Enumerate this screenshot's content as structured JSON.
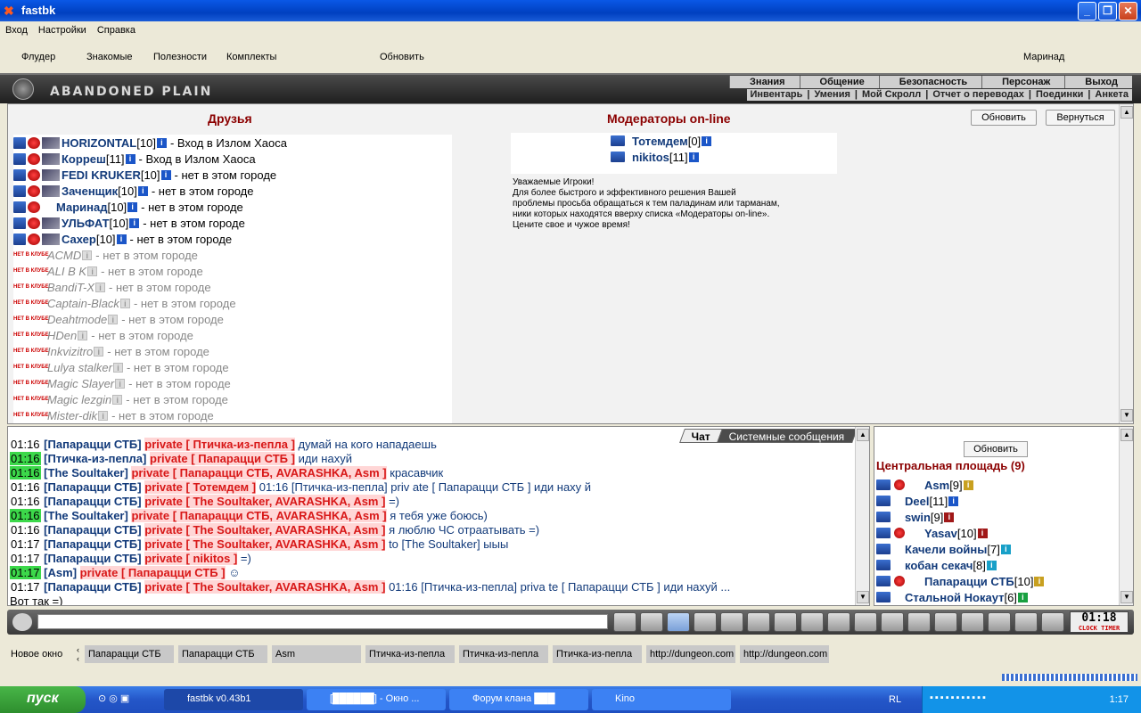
{
  "window": {
    "title": "fastbk"
  },
  "menubar": [
    "Вход",
    "Настройки",
    "Справка"
  ],
  "toolbar": {
    "items": [
      "Флудер",
      "Знакомые",
      "Полезности",
      "Комплекты",
      "Обновить"
    ],
    "user": "Маринад"
  },
  "game": {
    "brand": "ABANDONED PLAIN",
    "menu_top": [
      "Знания",
      "Общение",
      "Безопасность",
      "Персонаж",
      "Выход"
    ],
    "menu_bottom": [
      "Инвентарь",
      "Умения",
      "Мой Скролл",
      "Отчет о переводах",
      "Поединки",
      "Анкета"
    ]
  },
  "friends": {
    "title": "Друзья",
    "refresh": "Обновить",
    "back": "Вернуться",
    "online": [
      {
        "nick": "HORIZONTAL",
        "level": "[10]",
        "status": "- Вход в Излом Хаоса"
      },
      {
        "nick": "Корреш",
        "level": "[11]",
        "status": "- Вход в Излом Хаоса"
      },
      {
        "nick": "FEDI KRUKER",
        "level": "[10]",
        "status": "- нет в этом городе"
      },
      {
        "nick": "Заченщик",
        "level": "[10]",
        "status": "- нет в этом городе"
      },
      {
        "nick": "Маринад",
        "level": "[10]",
        "status": "- нет в этом городе"
      },
      {
        "nick": "УЛЬФАТ",
        "level": "[10]",
        "status": "- нет в этом городе"
      },
      {
        "nick": "Сахер",
        "level": "[10]",
        "status": "- нет в этом городе"
      }
    ],
    "offline_badge": "НЕТ В КЛУБЕ",
    "offline": [
      {
        "nick": "ACMD",
        "status": "- нет в этом городе"
      },
      {
        "nick": "ALI B K",
        "status": "- нет в этом городе"
      },
      {
        "nick": "BandiT-X",
        "status": "- нет в этом городе"
      },
      {
        "nick": "Captain-Black",
        "status": "- нет в этом городе"
      },
      {
        "nick": "Deahtmode",
        "status": "- нет в этом городе"
      },
      {
        "nick": "HDen",
        "status": "- нет в этом городе"
      },
      {
        "nick": "Inkvizitro",
        "status": "- нет в этом городе"
      },
      {
        "nick": "Lulya stalker",
        "status": "- нет в этом городе"
      },
      {
        "nick": "Magic Slayer",
        "status": "- нет в этом городе"
      },
      {
        "nick": "Magic lezgin",
        "status": "- нет в этом городе"
      },
      {
        "nick": "Mister-dik",
        "status": "- нет в этом городе"
      }
    ]
  },
  "moderators": {
    "title": "Модераторы on-line",
    "list": [
      {
        "nick": "Тотемдем",
        "level": "[0]"
      },
      {
        "nick": "nikitos",
        "level": "[11]"
      }
    ],
    "note": [
      "Уважаемые Игроки!",
      "Для более быстрого и эффективного решения Вашей",
      "проблемы просьба обращаться к тем паладинам или тарманам,",
      "ники которых находятся вверху списка «Модераторы on-line».",
      "Цените свое и чужое время!"
    ]
  },
  "chat": {
    "tabs": [
      "Чат",
      "Системные сообщения"
    ],
    "lines": [
      {
        "time": "01:16",
        "hl": false,
        "from": "Папарацци СТБ",
        "priv": "private",
        "to": "[ Птичка-из-пепла ]",
        "msg": "думай на кого нападаешь"
      },
      {
        "time": "01:16",
        "hl": true,
        "from": "Птичка-из-пепла",
        "priv": "private",
        "to": "[ Папарацци СТБ ]",
        "msg": "иди нахуй"
      },
      {
        "time": "01:16",
        "hl": true,
        "from": "The Soultaker",
        "priv": "private",
        "to": "[ Папарацци СТБ, AVARASHKA, Asm ]",
        "msg": "красавчик"
      },
      {
        "time": "01:16",
        "hl": false,
        "from": "Папарацци СТБ",
        "priv": "private",
        "to": "[ Тотемдем ]",
        "msg": "01:16 [Птичка-из-пепла] priv ate [ Папарацци СТБ ] иди наху й"
      },
      {
        "time": "01:16",
        "hl": false,
        "from": "Папарацци СТБ",
        "priv": "private",
        "to": "[ The Soultaker, AVARASHKA, Asm ]",
        "msg": "=)"
      },
      {
        "time": "01:16",
        "hl": true,
        "from": "The Soultaker",
        "priv": "private",
        "to": "[ Папарацци СТБ, AVARASHKA, Asm ]",
        "msg": "я тебя уже боюсь)"
      },
      {
        "time": "01:16",
        "hl": false,
        "from": "Папарацци СТБ",
        "priv": "private",
        "to": "[ The Soultaker, AVARASHKA, Asm ]",
        "msg": "я люблю ЧС отраатывать =)"
      },
      {
        "time": "01:17",
        "hl": false,
        "from": "Папарацци СТБ",
        "priv": "private",
        "to": "[ The Soultaker, AVARASHKA, Asm ]",
        "msg": "to [The Soultaker] ыыы"
      },
      {
        "time": "01:17",
        "hl": false,
        "from": "Папарацци СТБ",
        "priv": "private",
        "to": "[ nikitos ]",
        "msg": "=)"
      },
      {
        "time": "01:17",
        "hl": true,
        "from": "Asm",
        "priv": "private",
        "to": "[ Папарацци СТБ ]",
        "msg": "☺"
      },
      {
        "time": "01:17",
        "hl": false,
        "from": "Папарацци СТБ",
        "priv": "private",
        "to": "[ The Soultaker, AVARASHKA, Asm ]",
        "msg": "01:16 [Птичка-из-пепла] priva te [ Папарацци СТБ ] иди нахуй ..."
      }
    ],
    "tail": "Вот так =)"
  },
  "room": {
    "refresh": "Обновить",
    "title": "Центральная площадь (9)",
    "users": [
      {
        "nick": "Asm",
        "level": "[9]"
      },
      {
        "nick": "Deel",
        "level": "[11]"
      },
      {
        "nick": "swin",
        "level": "[9]"
      },
      {
        "nick": "Yasav",
        "level": "[10]"
      },
      {
        "nick": "Качели войны",
        "level": "[7]"
      },
      {
        "nick": "кобан секач",
        "level": "[8]"
      },
      {
        "nick": "Папарацци СТБ",
        "level": "[10]"
      },
      {
        "nick": "Стальной Нокаут",
        "level": "[6]"
      }
    ]
  },
  "clock": {
    "time": "01:18",
    "label": "CLOCK TIMER"
  },
  "tabs": {
    "new_window": "Новое окно",
    "items": [
      "Папарацци СТБ",
      "Папарацци СТБ",
      "Asm",
      "Птичка-из-пепла",
      "Птичка-из-пепла",
      "Птичка-из-пепла",
      "http://dungeon.com",
      "http://dungeon.com"
    ]
  },
  "taskbar": {
    "start": "пуск",
    "tasks": [
      "fastbk v0.43b1",
      "[██████] - Окно ...",
      "Форум клана ███",
      "Kino"
    ],
    "lang_left": "RL",
    "time": "1:17"
  }
}
